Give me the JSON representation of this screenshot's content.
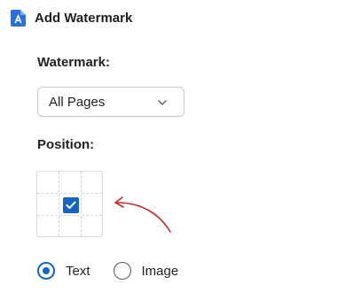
{
  "header": {
    "title": "Add Watermark",
    "icon": "pdf-document-icon",
    "icon_color": "#2f6fd6"
  },
  "watermark": {
    "label": "Watermark:",
    "selected": "All Pages"
  },
  "position": {
    "label": "Position:",
    "grid_rows": 3,
    "grid_cols": 3,
    "selected_cell": "middle-left"
  },
  "type": {
    "options": [
      {
        "label": "Text",
        "checked": true
      },
      {
        "label": "Image",
        "checked": false
      }
    ]
  },
  "colors": {
    "accent": "#1565c0",
    "annotation_arrow": "#c62828"
  }
}
